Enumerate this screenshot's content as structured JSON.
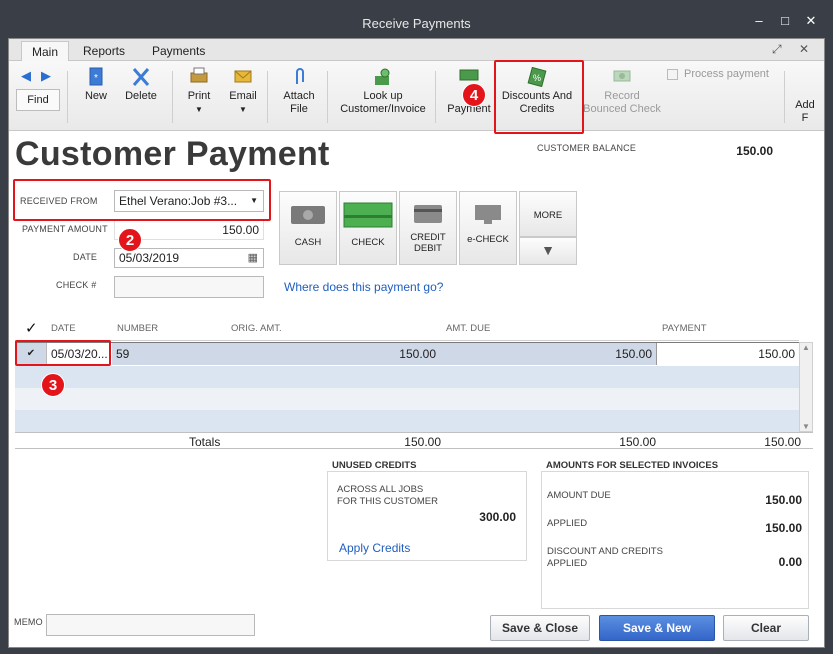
{
  "window": {
    "title": "Receive Payments"
  },
  "tabs": [
    {
      "label": "Main"
    },
    {
      "label": "Reports"
    },
    {
      "label": "Payments"
    }
  ],
  "toolbar": {
    "find": "Find",
    "new": "New",
    "delete": "Delete",
    "print": "Print",
    "email": "Email",
    "attach_line1": "Attach",
    "attach_line2": "File",
    "lookup_line1": "Look up",
    "lookup_line2": "Customer/Invoice",
    "undo_line1": "Un",
    "undo_line2": "Payment",
    "discounts_line1": "Discounts And",
    "discounts_line2": "Credits",
    "record_line1": "Record",
    "record_line2": "Bounced Check",
    "process_payment": "Process payment",
    "add_line1": "Add",
    "add_line2": "F"
  },
  "form": {
    "heading": "Customer Payment",
    "customer_balance_label": "CUSTOMER BALANCE",
    "customer_balance_value": "150.00",
    "received_from_label": "RECEIVED FROM",
    "received_from_value": "Ethel Verano:Job #3...",
    "payment_amount_label": "PAYMENT AMOUNT",
    "payment_amount_value": "150.00",
    "date_label": "DATE",
    "date_value": "05/03/2019",
    "check_label": "CHECK #",
    "check_value": "",
    "where_link": "Where does this payment go?"
  },
  "payment_methods": [
    {
      "label": "CASH"
    },
    {
      "label": "CHECK"
    },
    {
      "label": "CREDIT DEBIT"
    },
    {
      "label": "e-CHECK"
    },
    {
      "label": "MORE"
    }
  ],
  "table": {
    "check_header": "✓",
    "headers": [
      "DATE",
      "NUMBER",
      "ORIG. AMT.",
      "AMT. DUE",
      "PAYMENT"
    ],
    "rows": [
      {
        "date": "05/03/20...",
        "number": "59",
        "orig": "150.00",
        "due": "150.00",
        "payment": "150.00"
      }
    ],
    "totals_label": "Totals",
    "totals_orig": "150.00",
    "totals_due": "150.00",
    "totals_payment": "150.00"
  },
  "unused_credits": {
    "title": "UNUSED CREDITS",
    "across_line1": "ACROSS ALL JOBS",
    "across_line2": "FOR THIS CUSTOMER",
    "value": "300.00",
    "apply_link": "Apply Credits"
  },
  "amounts": {
    "title": "AMOUNTS FOR SELECTED INVOICES",
    "amount_due_label": "AMOUNT DUE",
    "amount_due_value": "150.00",
    "applied_label": "APPLIED",
    "applied_value": "150.00",
    "discount_line1": "DISCOUNT AND CREDITS",
    "discount_line2": "APPLIED",
    "discount_value": "0.00"
  },
  "memo": {
    "label": "MEMO",
    "value": ""
  },
  "buttons": {
    "save_close": "Save & Close",
    "save_new": "Save & New",
    "clear": "Clear"
  },
  "annotations": {
    "b2": "2",
    "b3": "3",
    "b4": "4"
  },
  "colors": {
    "highlight": "#e3151a",
    "link": "#1f5fbf",
    "primary": "#3366c9"
  }
}
